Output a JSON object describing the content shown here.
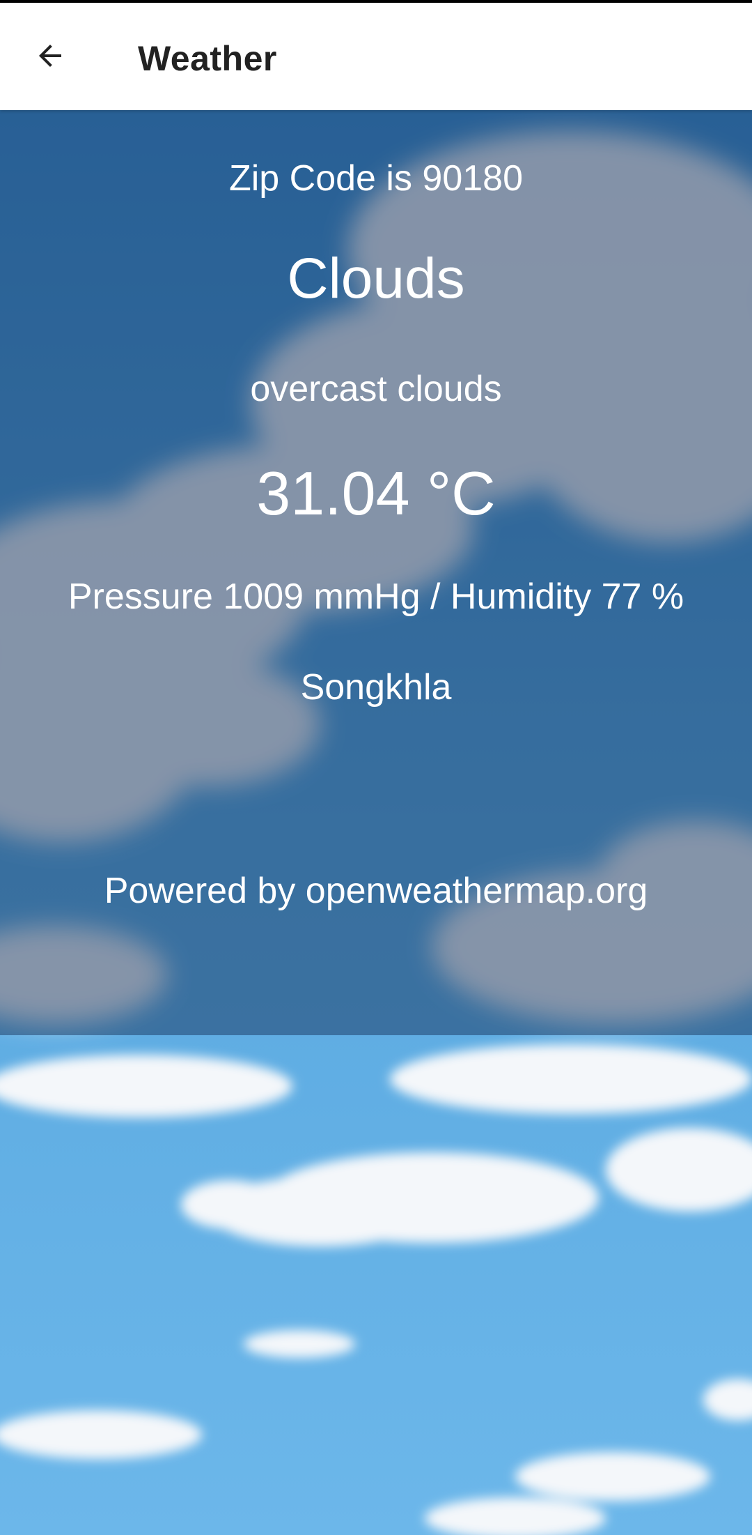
{
  "app_bar": {
    "title": "Weather",
    "back_icon": "arrow-back-icon"
  },
  "weather": {
    "zip_line": "Zip Code is 90180",
    "main": "Clouds",
    "description": "overcast clouds",
    "temperature": "31.04 °C",
    "pressure_humidity": "Pressure 1009 mmHg / Humidity 77 %",
    "city": "Songkhla",
    "powered_by": "Powered by openweathermap.org"
  },
  "colors": {
    "app_bar_bg": "#ffffff",
    "title_color": "#222222",
    "sky_blue": "#5fb0e6",
    "text_color": "#ffffff"
  }
}
